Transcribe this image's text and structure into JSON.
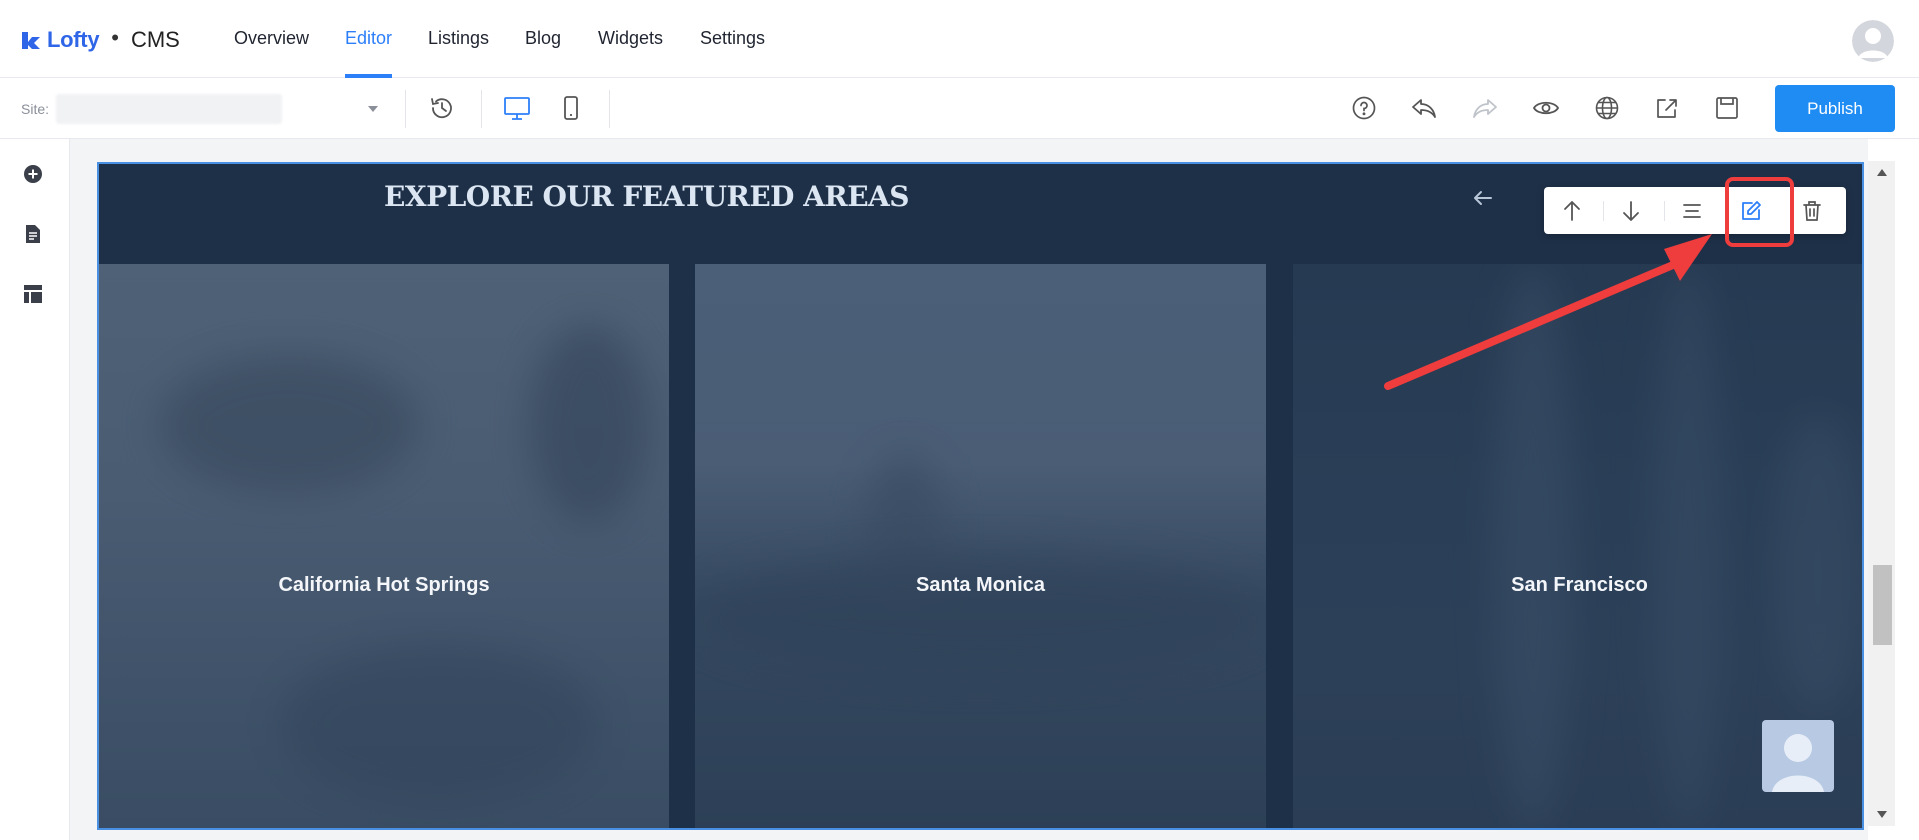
{
  "brand": {
    "name": "Lofty",
    "separator": "•",
    "product": "CMS"
  },
  "nav": {
    "items": [
      {
        "label": "Overview"
      },
      {
        "label": "Editor",
        "active": true
      },
      {
        "label": "Listings"
      },
      {
        "label": "Blog"
      },
      {
        "label": "Widgets"
      },
      {
        "label": "Settings"
      }
    ]
  },
  "toolbar": {
    "site_label": "Site:",
    "site_value": "",
    "left_icons": [
      "history-icon",
      "desktop-view-icon",
      "mobile-view-icon"
    ],
    "right_icons": [
      "help-icon",
      "undo-icon",
      "redo-icon",
      "preview-eye-icon",
      "globe-icon",
      "share-export-icon",
      "save-icon"
    ],
    "publish_label": "Publish"
  },
  "left_rail": {
    "icons": [
      "add-section-icon",
      "pages-icon",
      "layout-icon"
    ]
  },
  "section": {
    "title": "EXPLORE OUR FEATURED AREAS",
    "cards": [
      {
        "label": "California Hot Springs"
      },
      {
        "label": "Santa Monica"
      },
      {
        "label": "San Francisco"
      }
    ]
  },
  "block_toolbar": {
    "icons": [
      "move-up-icon",
      "move-down-icon",
      "align-icon",
      "edit-icon",
      "delete-icon"
    ]
  },
  "colors": {
    "accent": "#2d7ff9",
    "publish": "#1f8cf3",
    "section_bg": "#1e3048",
    "annotation": "#ef3c3c"
  }
}
